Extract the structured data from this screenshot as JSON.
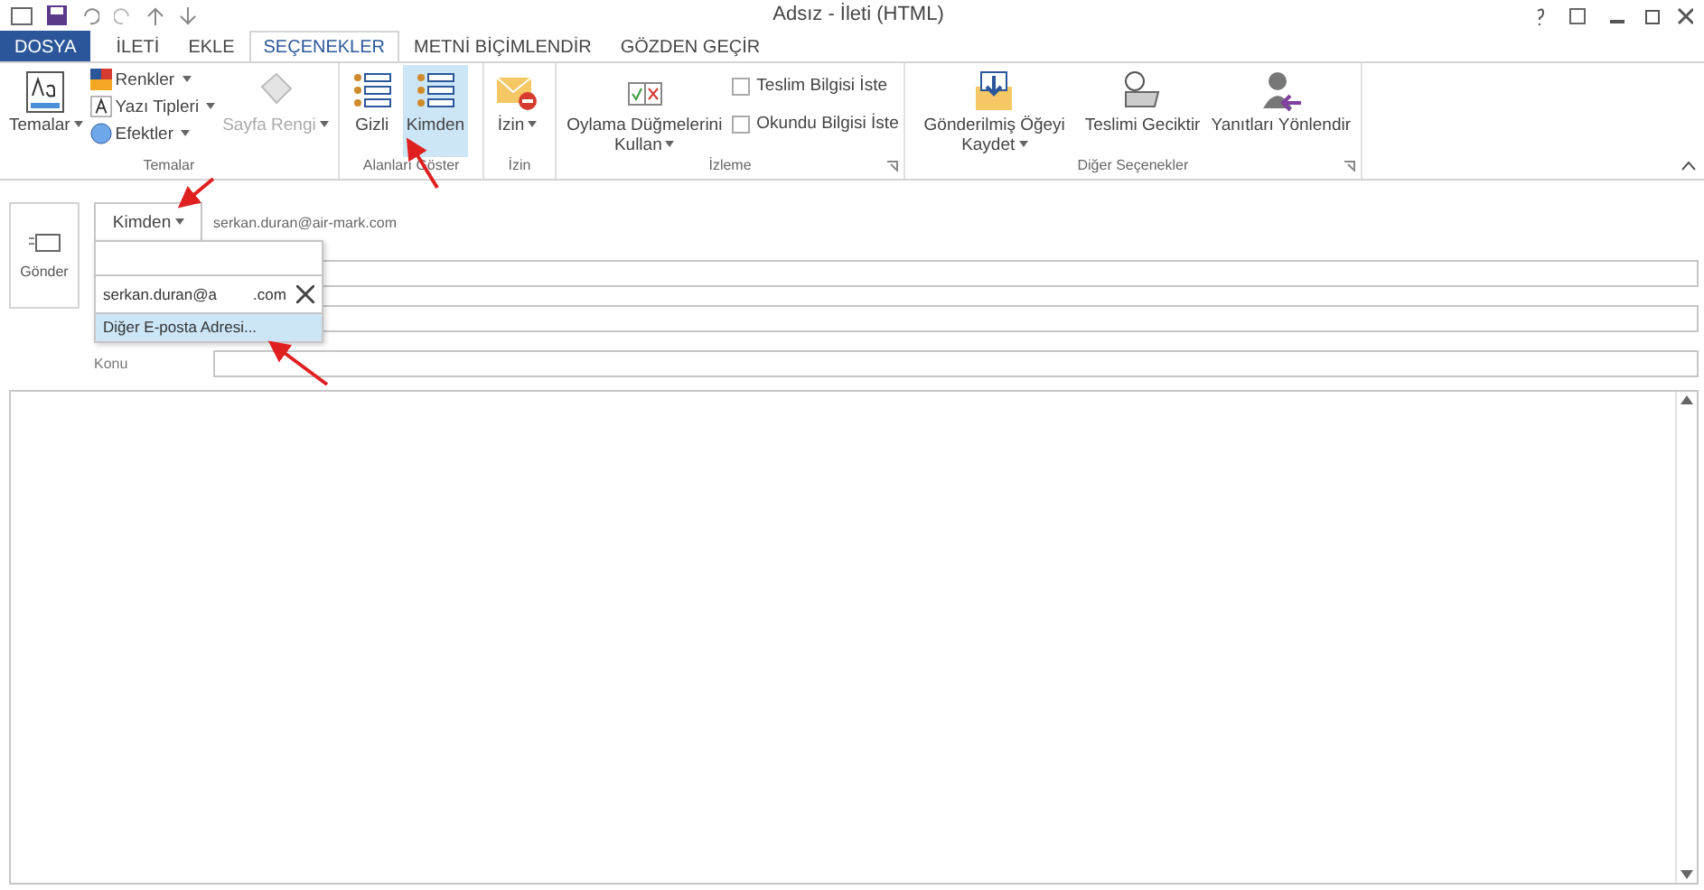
{
  "window": {
    "title": "Adsız - İleti (HTML)"
  },
  "tabs": [
    {
      "label": "DOSYA",
      "kind": "file",
      "selected": false
    },
    {
      "label": "İLETİ",
      "kind": "tab",
      "selected": false
    },
    {
      "label": "EKLE",
      "kind": "tab",
      "selected": false
    },
    {
      "label": "SEÇENEKLER",
      "kind": "tab",
      "selected": true
    },
    {
      "label": "METNİ BİÇİMLENDİR",
      "kind": "tab",
      "selected": false
    },
    {
      "label": "GÖZDEN GEÇİR",
      "kind": "tab",
      "selected": false
    }
  ],
  "ribbon": {
    "groups": [
      {
        "label": "Temalar",
        "items": [
          {
            "kind": "big",
            "label": "Temalar",
            "caret": true,
            "selected": false,
            "disabled": false
          },
          {
            "kind": "stack",
            "entries": [
              {
                "label": "Renkler"
              },
              {
                "label": "Yazı Tipleri"
              },
              {
                "label": "Efektler"
              }
            ]
          },
          {
            "kind": "big",
            "label": "Sayfa Rengi",
            "caret": true,
            "selected": false,
            "disabled": true
          }
        ]
      },
      {
        "label": "Alanları Göster",
        "items": [
          {
            "kind": "big",
            "label": "Gizli",
            "caret": false,
            "selected": false,
            "disabled": false
          },
          {
            "kind": "big",
            "label": "Kimden",
            "caret": false,
            "selected": true,
            "disabled": false
          }
        ]
      },
      {
        "label": "İzin",
        "items": [
          {
            "kind": "big",
            "label": "İzin",
            "caret": true,
            "selected": false,
            "disabled": false
          }
        ]
      },
      {
        "label": "İzleme",
        "launcher": true,
        "items": [
          {
            "kind": "big",
            "label": "Oylama Düğmelerini Kullan",
            "caret": true,
            "selected": false,
            "disabled": false
          },
          {
            "kind": "checks",
            "entries": [
              {
                "label": "Teslim Bilgisi İste",
                "checked": false
              },
              {
                "label": "Okundu Bilgisi İste",
                "checked": false
              }
            ]
          }
        ]
      },
      {
        "label": "Diğer Seçenekler",
        "launcher": true,
        "items": [
          {
            "kind": "big",
            "label": "Gönderilmiş Öğeyi Kaydet",
            "caret": true,
            "selected": false,
            "disabled": false
          },
          {
            "kind": "big",
            "label": "Teslimi Geciktir",
            "caret": false,
            "selected": false,
            "disabled": false
          },
          {
            "kind": "big",
            "label": "Yanıtları Yönlendir",
            "caret": false,
            "selected": false,
            "disabled": false
          }
        ]
      }
    ]
  },
  "compose": {
    "send": "Gönder",
    "from_button": "Kimden",
    "from_address": "serkan.duran@air-mark.com",
    "subject_label": "Konu",
    "dropdown": {
      "address_start": "serkan.duran@a",
      "address_end": ".com",
      "items": [
        {
          "label": "Diğer E-posta Adresi...",
          "selected": true
        }
      ]
    }
  }
}
